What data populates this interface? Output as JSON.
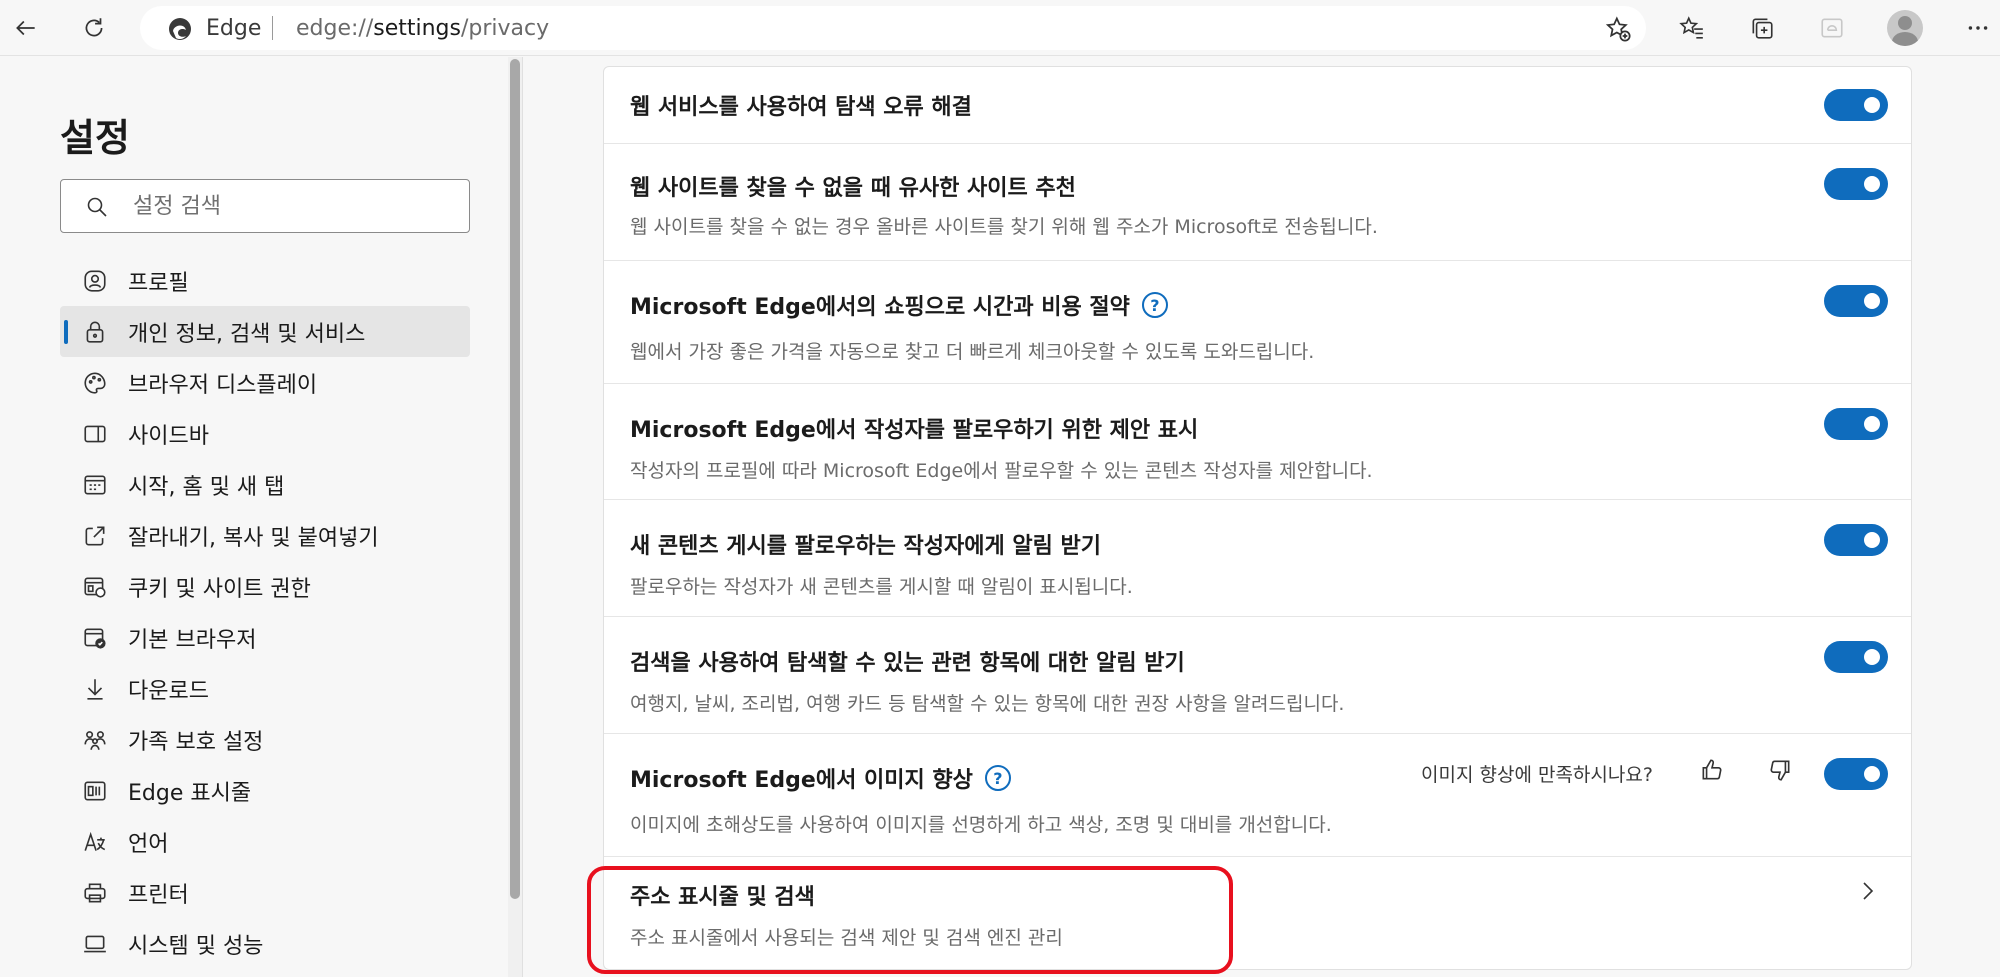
{
  "browser": {
    "brand": "Edge",
    "url_prefix": "edge://",
    "url_main": "settings",
    "url_suffix": "/privacy"
  },
  "sidebar": {
    "title": "설정",
    "search_placeholder": "설정 검색",
    "items": [
      {
        "label": "프로필",
        "icon": "profile-icon",
        "active": false
      },
      {
        "label": "개인 정보, 검색 및 서비스",
        "icon": "lock-icon",
        "active": true
      },
      {
        "label": "브라우저 디스플레이",
        "icon": "palette-icon",
        "active": false
      },
      {
        "label": "사이드바",
        "icon": "sidebar-icon",
        "active": false
      },
      {
        "label": "시작, 홈 및 새 탭",
        "icon": "home-tab-icon",
        "active": false
      },
      {
        "label": "잘라내기, 복사 및 붙여넣기",
        "icon": "share-icon",
        "active": false
      },
      {
        "label": "쿠키 및 사이트 권한",
        "icon": "cookie-icon",
        "active": false
      },
      {
        "label": "기본 브라우저",
        "icon": "default-browser-icon",
        "active": false
      },
      {
        "label": "다운로드",
        "icon": "download-icon",
        "active": false
      },
      {
        "label": "가족 보호 설정",
        "icon": "family-icon",
        "active": false
      },
      {
        "label": "Edge 표시줄",
        "icon": "edge-bar-icon",
        "active": false
      },
      {
        "label": "언어",
        "icon": "language-icon",
        "active": false
      },
      {
        "label": "프린터",
        "icon": "printer-icon",
        "active": false
      },
      {
        "label": "시스템 및 성능",
        "icon": "laptop-icon",
        "active": false
      }
    ]
  },
  "settings": [
    {
      "title": "웹 서비스를 사용하여 탐색 오류 해결",
      "desc": "",
      "toggle": true
    },
    {
      "title": "웹 사이트를 찾을 수 없을 때 유사한 사이트 추천",
      "desc": "웹 사이트를 찾을 수 없는 경우 올바른 사이트를 찾기 위해 웹 주소가 Microsoft로 전송됩니다.",
      "toggle": true
    },
    {
      "title": "Microsoft Edge에서의 쇼핑으로 시간과 비용 절약",
      "desc": "웹에서 가장 좋은 가격을 자동으로 찾고 더 빠르게 체크아웃할 수 있도록 도와드립니다.",
      "toggle": true,
      "help": "?"
    },
    {
      "title": "Microsoft Edge에서 작성자를 팔로우하기 위한 제안 표시",
      "desc": "작성자의 프로필에 따라 Microsoft Edge에서 팔로우할 수 있는 콘텐츠 작성자를 제안합니다.",
      "toggle": true
    },
    {
      "title": "새 콘텐츠 게시를 팔로우하는 작성자에게 알림 받기",
      "desc": "팔로우하는 작성자가 새 콘텐츠를 게시할 때 알림이 표시됩니다.",
      "toggle": true
    },
    {
      "title": "검색을 사용하여 탐색할 수 있는 관련 항목에 대한 알림 받기",
      "desc": "여행지, 날씨, 조리법, 여행 카드 등 탐색할 수 있는 항목에 대한 권장 사항을 알려드립니다.",
      "toggle": true
    },
    {
      "title": "Microsoft Edge에서 이미지 향상",
      "desc": "이미지에 초해상도를 사용하여 이미지를 선명하게 하고 색상, 조명 및 대비를 개선합니다.",
      "toggle": true,
      "help": "?",
      "feedback_question": "이미지 향상에 만족하시나요?"
    },
    {
      "title": "주소 표시줄 및 검색",
      "desc": "주소 표시줄에서 사용되는 검색 제안 및 검색 엔진 관리",
      "link": true
    }
  ],
  "colors": {
    "accent": "#0f6cbd",
    "highlight": "#e8101e"
  }
}
